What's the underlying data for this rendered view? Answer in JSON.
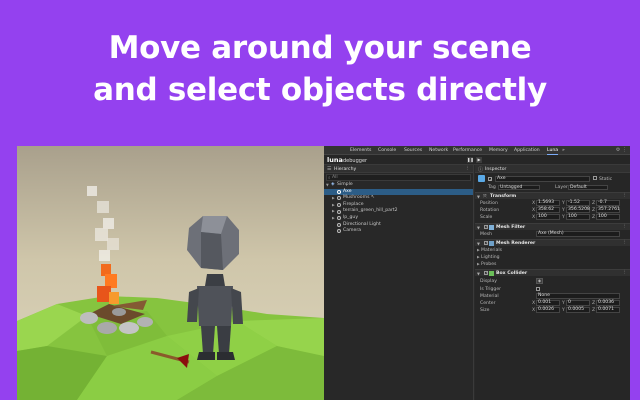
{
  "headline": {
    "line1": "Move around your scene",
    "line2": "and select objects directly"
  },
  "devtools": {
    "tabs": [
      "Elements",
      "Console",
      "Sources",
      "Network",
      "Performance",
      "Memory",
      "Application",
      "Luna",
      "»"
    ],
    "active_tab": "Luna",
    "top_icons": "⚙ ⋮",
    "logo": "luna",
    "subtitle": "debugger",
    "controls": {
      "pause": "❚❚",
      "step": "▶"
    }
  },
  "hierarchy": {
    "title": "Hierarchy",
    "search_placeholder": "All",
    "root": "Simple",
    "items": [
      {
        "label": "Axe",
        "selected": true
      },
      {
        "label": "Mushrooms",
        "expand": true
      },
      {
        "label": "Fireplace",
        "expand": true
      },
      {
        "label": "terrain_green_hill_part2",
        "expand": true
      },
      {
        "label": "lp_guy",
        "expand": true
      },
      {
        "label": "Directional Light",
        "expand": false
      },
      {
        "label": "Camera",
        "expand": false
      }
    ]
  },
  "inspector": {
    "title": "Inspector",
    "object_name": "Axe",
    "static_label": "Static",
    "tag_label": "Tag",
    "tag_value": "Untagged",
    "layer_label": "Layer",
    "layer_value": "Default",
    "transform": {
      "title": "Transform",
      "rows": [
        {
          "label": "Position",
          "x": "1.5693",
          "y": "-1.52",
          "z": "-0.7"
        },
        {
          "label": "Rotation",
          "x": "358.62",
          "y": "356.5208",
          "z": "357.2761"
        },
        {
          "label": "Scale",
          "x": "100",
          "y": "100",
          "z": "100"
        }
      ]
    },
    "mesh_filter": {
      "title": "Mesh Filter",
      "mesh_label": "Mesh",
      "mesh_value": "Axe (Mesh)"
    },
    "mesh_renderer": {
      "title": "Mesh Renderer",
      "sub": [
        "Materials",
        "Lighting",
        "Probes"
      ]
    },
    "box_collider": {
      "title": "Box Collider",
      "display_label": "Display",
      "is_trigger_label": "Is Trigger",
      "material_label": "Material",
      "material_value": "None",
      "center_label": "Center",
      "center": {
        "x": "0.001",
        "y": "0",
        "z": "0.0036"
      },
      "size_label": "Size",
      "size": {
        "x": "0.0026",
        "y": "0.0005",
        "z": "0.0071"
      }
    },
    "axis_letters": {
      "x": "X",
      "y": "Y",
      "z": "Z"
    }
  },
  "colors": {
    "background": "#9441ef",
    "selection": "#2c5d87",
    "grass": "#8ed14a",
    "fire": "#f26a1b"
  }
}
